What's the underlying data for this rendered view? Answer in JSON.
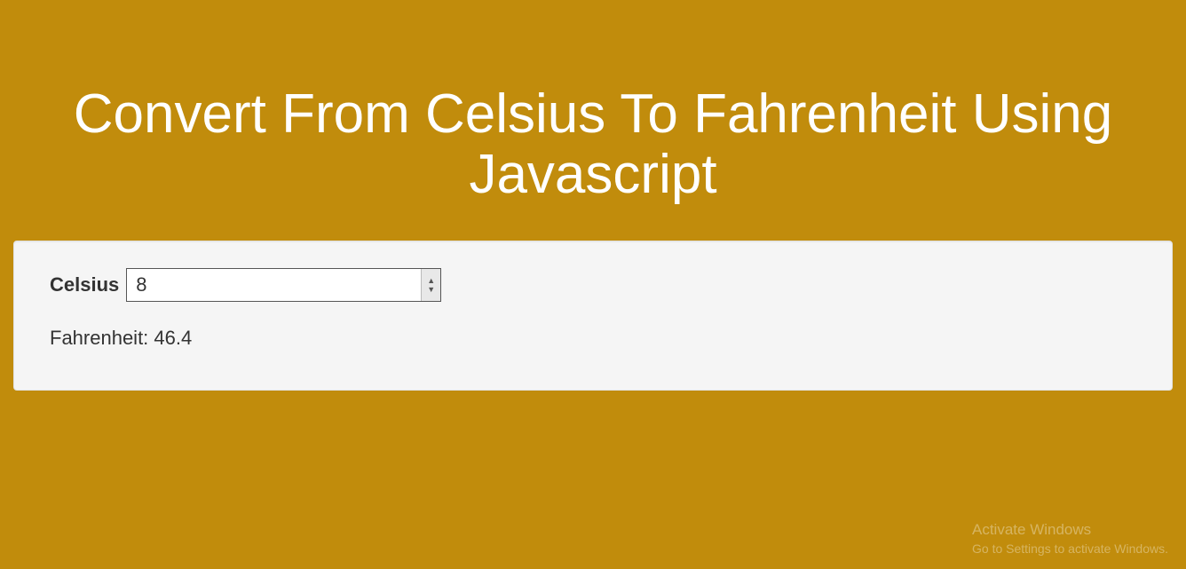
{
  "title": "Convert From Celsius To Fahrenheit Using Javascript",
  "form": {
    "celsius_label": "Celsius",
    "celsius_value": "8",
    "fahrenheit_label": "Fahrenheit:",
    "fahrenheit_value": "46.4"
  },
  "watermark": {
    "line1": "Activate Windows",
    "line2": "Go to Settings to activate Windows."
  }
}
